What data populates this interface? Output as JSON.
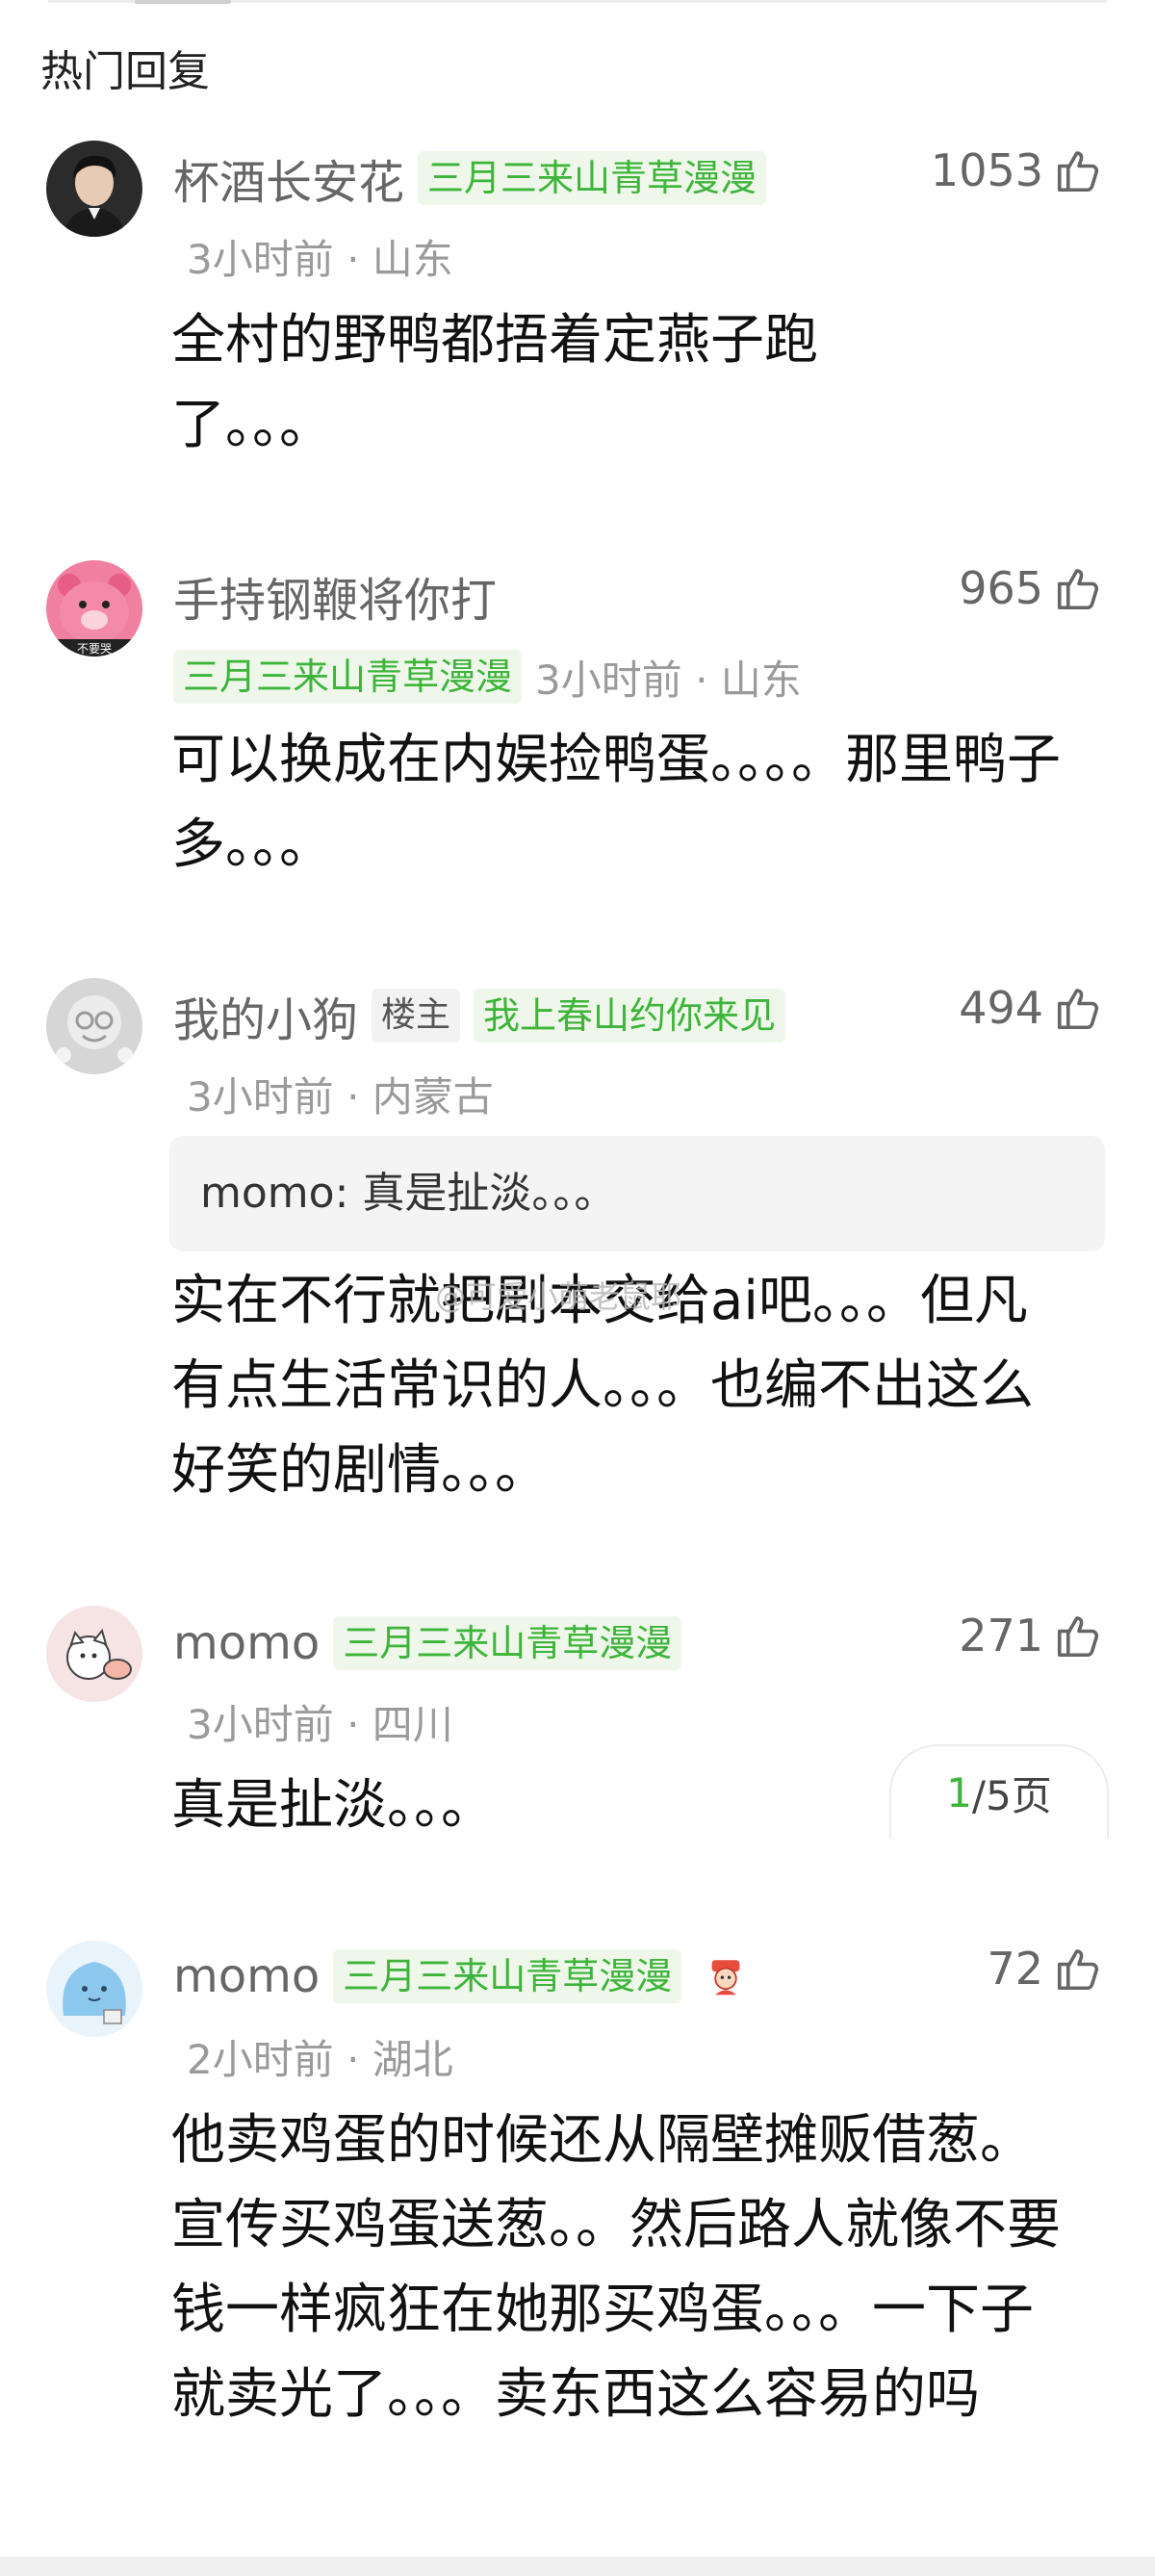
{
  "section": {
    "title": "热门回复"
  },
  "colors": {
    "tag_green": "#3db43a",
    "tag_bg": "#eef7ea",
    "meta_gray": "#9a9a9a"
  },
  "comments": [
    {
      "name": "杯酒长安花",
      "tag": "三月三来山青草漫漫",
      "meta": "3小时前 · 山东",
      "likes": "1053",
      "text": "全村的野鸭都捂着定燕子跑了。。。",
      "avatar_icon": "avatar-portrait-icon"
    },
    {
      "name": "手持钢鞭将你打",
      "tag": "三月三来山青草漫漫",
      "meta": "3小时前 · 山东",
      "likes": "965",
      "text": "可以换成在内娱捡鸭蛋。。。。那里鸭子多。。。",
      "avatar_icon": "avatar-pink-bear-icon",
      "avatar_text": "不要哭"
    },
    {
      "name": "我的小狗",
      "author_badge": "楼主",
      "tag": "我上春山约你来见",
      "meta": "3小时前 · 内蒙古",
      "likes": "494",
      "quote": "momo: 真是扯淡。。。",
      "text": "实在不行就把剧本交给ai吧。。。但凡有点生活常识的人。。。也编不出这么好笑的剧情。。。",
      "avatar_icon": "avatar-gray-face-icon"
    },
    {
      "name": "momo",
      "tag": "三月三来山青草漫漫",
      "meta": "3小时前 · 四川",
      "likes": "271",
      "text": "真是扯淡。。。",
      "avatar_icon": "avatar-cartoon-cat-icon"
    },
    {
      "name": "momo",
      "tag": "三月三来山青草漫漫",
      "meta": "2小时前 · 湖北",
      "likes": "72",
      "text": "他卖鸡蛋的时候还从隔壁摊贩借葱。宣传买鸡蛋送葱。。然后路人就像不要钱一样疯狂在她那买鸡蛋。。。一下子就卖光了。。。卖东西这么容易的吗",
      "avatar_icon": "avatar-blue-blob-icon",
      "badge_icon": "emoji-badge-icon"
    }
  ],
  "pager": {
    "current": "1",
    "total": "/5页"
  },
  "watermark": "@可爱小萌老鼠耶"
}
